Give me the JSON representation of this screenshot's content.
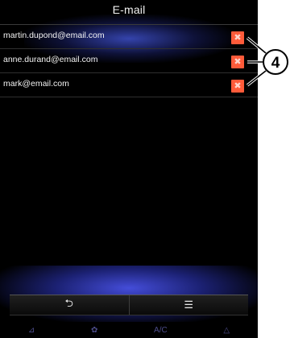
{
  "header": {
    "title": "E-mail"
  },
  "emails": [
    "martin.dupond@email.com",
    "anne.durand@email.com",
    "mark@email.com"
  ],
  "footer": {
    "back_icon": "⮌",
    "menu_icon": "☰"
  },
  "climate": {
    "seat_icon": "⊿",
    "fan_icon": "✿",
    "ac_label": "A/C",
    "defrost_icon": "△"
  },
  "callout": {
    "number": "4"
  },
  "colors": {
    "accent_blue": "#4a5ae6",
    "delete_red": "#ff5b3a"
  }
}
